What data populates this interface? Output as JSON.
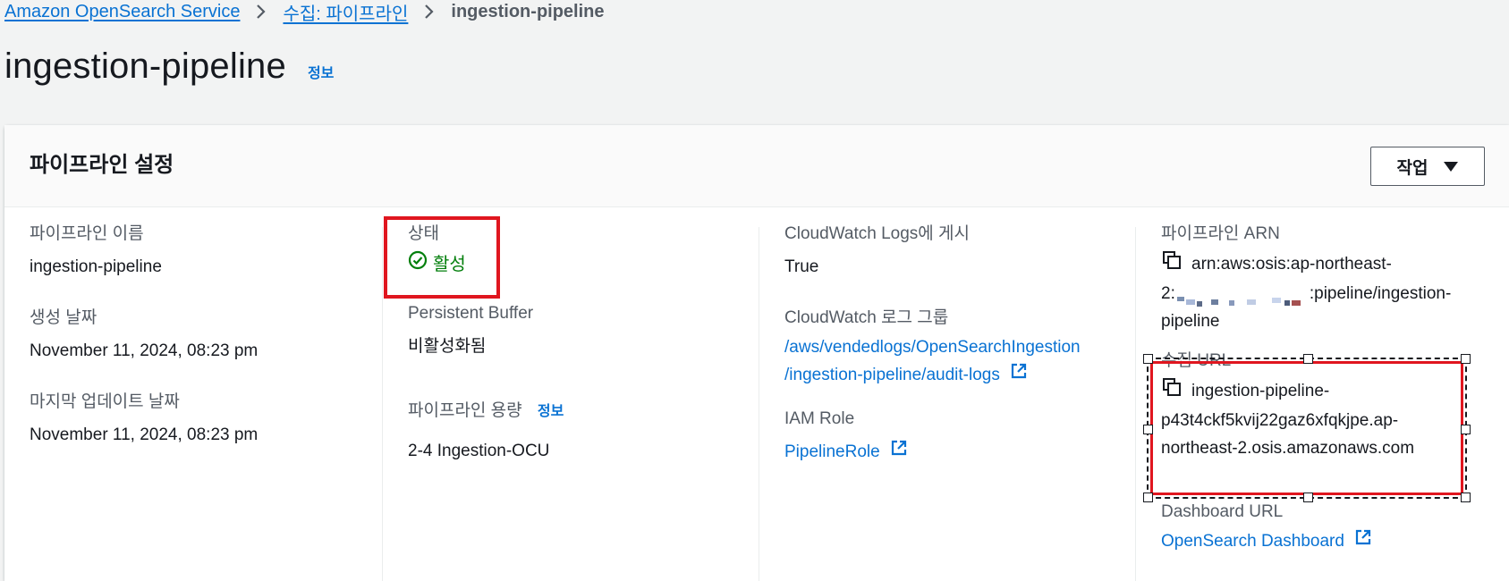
{
  "breadcrumb": {
    "items": [
      "Amazon OpenSearch Service",
      "수집: 파이프라인"
    ],
    "current": "ingestion-pipeline"
  },
  "page": {
    "title": "ingestion-pipeline",
    "info": "정보"
  },
  "panel": {
    "title": "파이프라인 설정",
    "actions_label": "작업"
  },
  "col1": {
    "name_label": "파이프라인 이름",
    "name_value": "ingestion-pipeline",
    "created_label": "생성 날짜",
    "created_value": "November 11, 2024, 08:23 pm",
    "updated_label": "마지막 업데이트 날짜",
    "updated_value": "November 11, 2024, 08:23 pm"
  },
  "col2": {
    "status_label": "상태",
    "status_value": "활성",
    "buffer_label": "Persistent Buffer",
    "buffer_value": "비활성화됨",
    "capacity_label": "파이프라인 용량",
    "capacity_info": "정보",
    "capacity_value": "2-4 Ingestion-OCU"
  },
  "col3": {
    "cw_publish_label": "CloudWatch Logs에 게시",
    "cw_publish_value": "True",
    "cw_group_label": "CloudWatch 로그 그룹",
    "cw_group_line1": "/aws/vendedlogs/OpenSearchIngestion",
    "cw_group_line2": "/ingestion-pipeline/audit-logs",
    "iam_label": "IAM Role",
    "iam_value": "PipelineRole"
  },
  "col4": {
    "arn_label": "파이프라인 ARN",
    "arn_line1": "arn:aws:osis:ap-northeast-",
    "arn_line2_prefix": "2:",
    "arn_line2_suffix": ":pipeline/ingestion-",
    "arn_line3": "pipeline",
    "url_label": "수집 URL",
    "url_line1": "ingestion-pipeline-",
    "url_line2": "p43t4ckf5kvij22gaz6xfqkjpe.ap-",
    "url_line3": "northeast-2.osis.amazonaws.com",
    "dashboard_label": "Dashboard URL",
    "dashboard_value": "OpenSearch Dashboard"
  },
  "colors": {
    "link": "#0972d3",
    "success": "#037f0c",
    "highlight": "#e0161f"
  }
}
